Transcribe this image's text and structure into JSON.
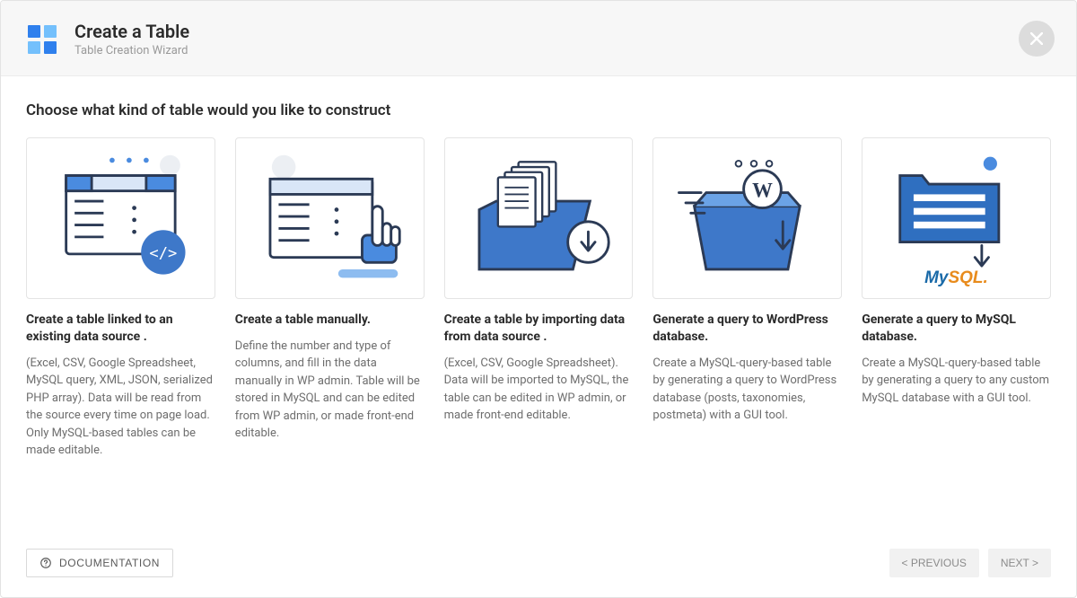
{
  "header": {
    "title": "Create a Table",
    "subtitle": "Table Creation Wizard"
  },
  "prompt": "Choose what kind of table would you like to construct",
  "cards": [
    {
      "title": "Create a table linked to an existing data source .",
      "desc": "(Excel, CSV, Google Spreadsheet, MySQL query, XML, JSON, serialized PHP array). Data will be read from the source every time on page load. Only MySQL-based tables can be made editable."
    },
    {
      "title": "Create a table manually.",
      "desc": "Define the number and type of columns, and fill in the data manually in WP admin. Table will be stored in MySQL and can be edited from WP admin, or made front-end editable."
    },
    {
      "title": "Create a table by importing data from data source .",
      "desc": "(Excel, CSV, Google Spreadsheet). Data will be imported to MySQL, the table can be edited in WP admin, or made front-end editable."
    },
    {
      "title": "Generate a query to WordPress database.",
      "desc": "Create a MySQL-query-based table by generating a query to WordPress database (posts, taxonomies, postmeta) with a GUI tool."
    },
    {
      "title": "Generate a query to MySQL database.",
      "desc": "Create a MySQL-query-based table by generating a query to any custom MySQL database with a GUI tool."
    }
  ],
  "footer": {
    "documentation": "DOCUMENTATION",
    "previous": "< PREVIOUS",
    "next": "NEXT >"
  },
  "card_icons": {
    "mysql_label": "MySQL."
  }
}
